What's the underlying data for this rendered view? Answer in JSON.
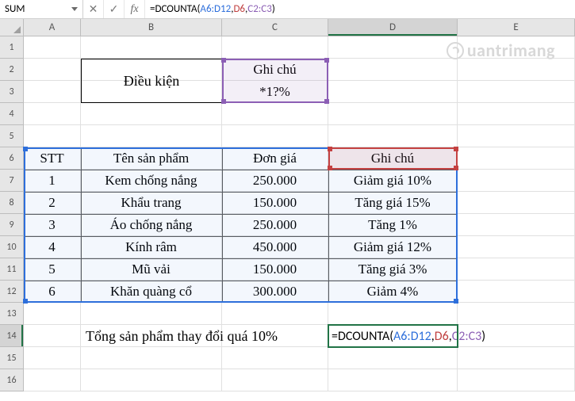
{
  "namebox": {
    "value": "SUM"
  },
  "formula_bar": {
    "pieces": {
      "eq": "=DCOUNTA(",
      "arg1": "A6:D12",
      "sep1": ",",
      "arg2": "D6",
      "sep2": ",",
      "arg3": "C2:C3",
      "close": ")"
    }
  },
  "columns": [
    "A",
    "B",
    "C",
    "D",
    "E"
  ],
  "rows": [
    "1",
    "2",
    "3",
    "4",
    "5",
    "6",
    "7",
    "8",
    "9",
    "10",
    "11",
    "12",
    "13",
    "14",
    "15",
    "16"
  ],
  "criteria": {
    "label": "Điều kiện",
    "header": "Ghi chú",
    "value": "*1?%"
  },
  "table": {
    "headers": {
      "stt": "STT",
      "name": "Tên sản phẩm",
      "price": "Đơn giá",
      "note": "Ghi chú"
    },
    "rows": [
      {
        "stt": "1",
        "name": "Kem chống nắng",
        "price": "250.000",
        "note": "Giảm giá 10%"
      },
      {
        "stt": "2",
        "name": "Khẩu trang",
        "price": "150.000",
        "note": "Tăng giá 15%"
      },
      {
        "stt": "3",
        "name": "Áo chống nắng",
        "price": "250.000",
        "note": "Tăng 1%"
      },
      {
        "stt": "4",
        "name": "Kính râm",
        "price": "450.000",
        "note": "Giảm giá 12%"
      },
      {
        "stt": "5",
        "name": "Mũ vải",
        "price": "150.000",
        "note": "Tăng giá 3%"
      },
      {
        "stt": "6",
        "name": "Khăn quàng cổ",
        "price": "300.000",
        "note": "Giảm 4%"
      }
    ]
  },
  "summary_label": "Tổng sản phẩm thay đổi quá 10%",
  "d14_formula": {
    "eq": "=DCOUNTA(",
    "arg1": "A6:D12",
    "sep1": ",",
    "arg2": "D6",
    "sep2": ",",
    "arg3": "C2:C3",
    "close": ")"
  },
  "watermark": "uantrimang"
}
